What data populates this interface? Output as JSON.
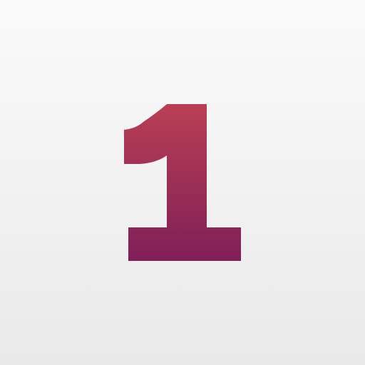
{
  "digit": "1",
  "colors": {
    "background_top": "#fafafa",
    "background_bottom": "#e9e9ea",
    "glyph_top": "#b93f55",
    "glyph_bottom": "#7f1f57"
  }
}
